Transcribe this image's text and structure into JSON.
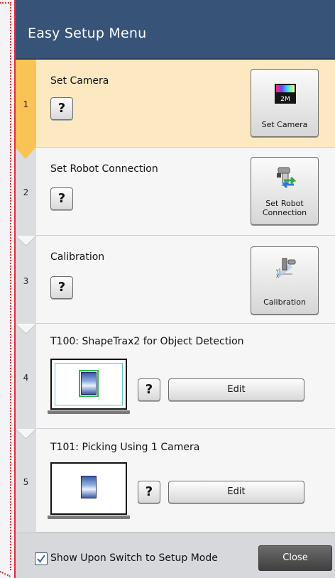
{
  "window": {
    "title": "Easy Setup Menu"
  },
  "steps": [
    {
      "number": "1",
      "title": "Set Camera",
      "help": "?",
      "button_label": "Set Camera",
      "badge": "2M"
    },
    {
      "number": "2",
      "title": "Set Robot Connection",
      "help": "?",
      "button_label": "Set Robot Connection"
    },
    {
      "number": "3",
      "title": "Calibration",
      "help": "?",
      "button_label": "Calibration"
    },
    {
      "number": "4",
      "title": "T100: ShapeTrax2 for Object Detection",
      "help": "?",
      "edit_label": "Edit"
    },
    {
      "number": "5",
      "title": "T101: Picking Using 1 Camera",
      "help": "?",
      "edit_label": "Edit"
    }
  ],
  "footer": {
    "checkbox_label": "Show Upon Switch to Setup Mode",
    "checkbox_checked": true,
    "close_label": "Close"
  },
  "colors": {
    "title_bar": "#375378",
    "active_step_bg": "#fde9c1",
    "active_step_rail": "#f9c455",
    "frame_border": "#d8303c"
  }
}
